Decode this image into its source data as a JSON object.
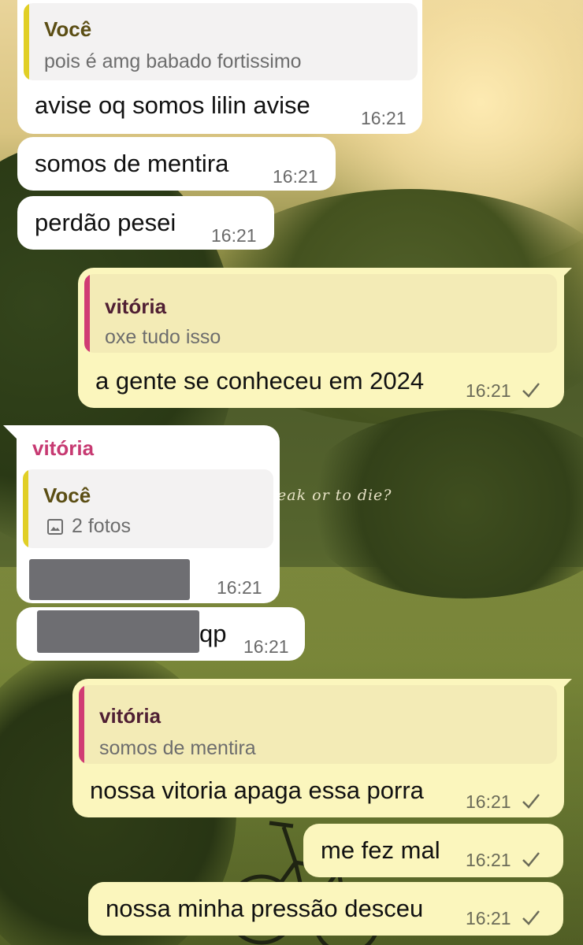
{
  "messages": [
    {
      "direction": "incoming",
      "reply": {
        "name": "Você",
        "text": "pois é amg babado fortissimo"
      },
      "text": "avise oq somos lilin avise",
      "time": "16:21"
    },
    {
      "direction": "incoming",
      "text": "somos de mentira",
      "time": "16:21"
    },
    {
      "direction": "incoming",
      "text": "perdão pesei",
      "time": "16:21"
    },
    {
      "direction": "outgoing",
      "reply": {
        "name": "vitória",
        "text": "oxe tudo isso"
      },
      "text": "a gente se conheceu em 2024",
      "time": "16:21",
      "status": "sent-check-icon"
    },
    {
      "direction": "incoming",
      "sender": "vitória",
      "reply": {
        "name": "Você",
        "text": "2 fotos",
        "icon": "photo-icon"
      },
      "text": "[redacted]",
      "time": "16:21"
    },
    {
      "direction": "incoming",
      "text": "qp",
      "time": "16:21"
    },
    {
      "direction": "outgoing",
      "reply": {
        "name": "vitória",
        "text": "somos de mentira"
      },
      "text": "nossa vitoria apaga essa porra",
      "time": "16:21",
      "status": "sent-check-icon"
    },
    {
      "direction": "outgoing",
      "text": "me fez mal",
      "time": "16:21",
      "status": "sent-check-icon"
    },
    {
      "direction": "outgoing",
      "text": "nossa minha pressão desceu",
      "time": "16:21",
      "status": "sent-check-icon"
    }
  ],
  "wallpaper": {
    "overlay_text": "eak or to die?"
  },
  "colors": {
    "incoming_bubble": "#ffffff",
    "outgoing_bubble": "#fbf6bd",
    "sender_name": "#c73a72",
    "reply_bar_you": "#e1cf26",
    "reply_bar_vitoria": "#d03c74"
  }
}
